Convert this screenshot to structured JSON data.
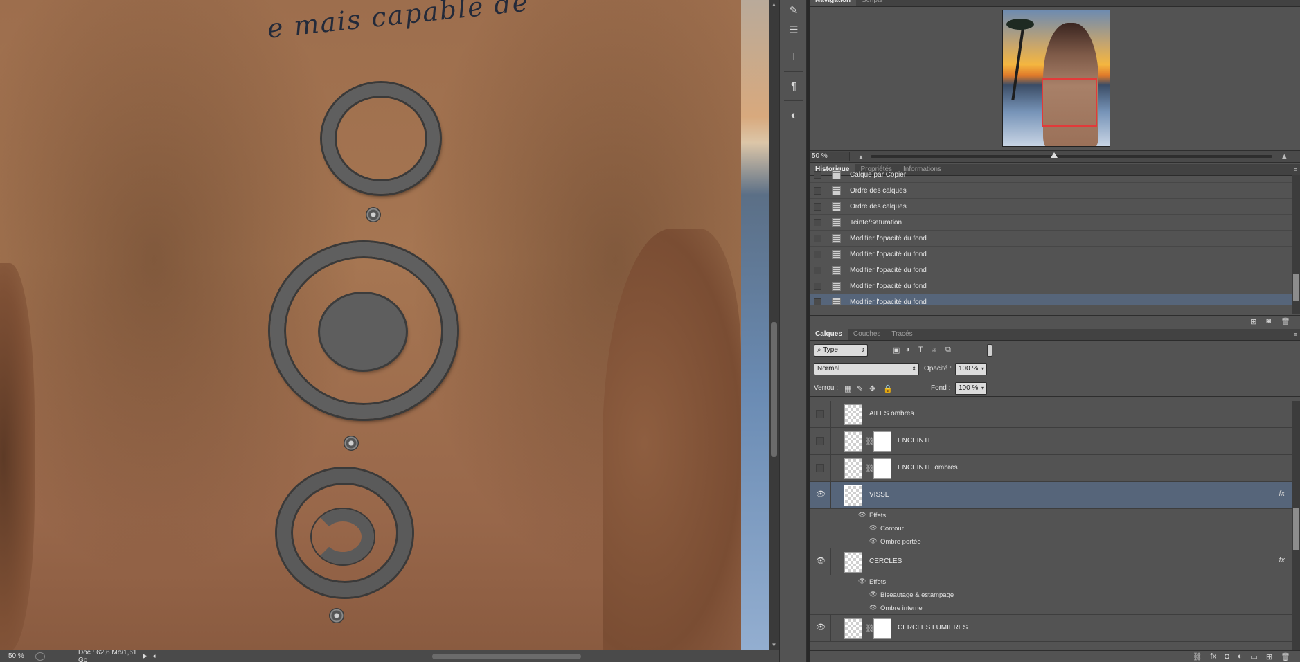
{
  "canvas": {
    "tattoo_text": "e mais capable de"
  },
  "status_bar": {
    "zoom": "50 %",
    "doc_info": "Doc : 62,6 Mo/1,61 Go"
  },
  "tools": [
    {
      "icon": "brush-presets-icon"
    },
    {
      "icon": "sliders-icon"
    },
    {
      "icon": "clone-source-icon"
    },
    {
      "icon": "paragraph-icon"
    },
    {
      "icon": "adjustment-icon"
    }
  ],
  "navigation": {
    "tabs": [
      "Navigation",
      "Scripts"
    ],
    "zoom": "50 %",
    "view_box_color": "#e23a3a"
  },
  "history": {
    "tabs": [
      "Historique",
      "Propriétés",
      "Informations"
    ],
    "items": [
      "Calque par Copier",
      "Ordre des calques",
      "Ordre des calques",
      "Teinte/Saturation",
      "Modifier l'opacité du fond",
      "Modifier l'opacité du fond",
      "Modifier l'opacité du fond",
      "Modifier l'opacité du fond",
      "Modifier l'opacité du fond"
    ],
    "active_index": 8
  },
  "layers": {
    "tabs": [
      "Calques",
      "Couches",
      "Tracés"
    ],
    "filter_kind": "Type",
    "blend_mode": "Normal",
    "opacity_label": "Opacité :",
    "opacity": "100 %",
    "lock_label": "Verrou :",
    "fill_label": "Fond :",
    "fill": "100 %",
    "items": [
      {
        "name": "AILES ombres"
      },
      {
        "name": "ENCEINTE"
      },
      {
        "name": "ENCEINTE ombres"
      },
      {
        "name": "VISSE",
        "effects_label": "Effets",
        "effects": [
          "Contour",
          "Ombre portée"
        ]
      },
      {
        "name": "CERCLES",
        "effects_label": "Effets",
        "effects": [
          "Biseautage & estampage",
          "Ombre interne"
        ]
      },
      {
        "name": "CERCLES LUMIERES"
      }
    ],
    "selected_index": 3
  },
  "colors": {
    "selection": "#56657a",
    "panel_bg": "#535353"
  }
}
